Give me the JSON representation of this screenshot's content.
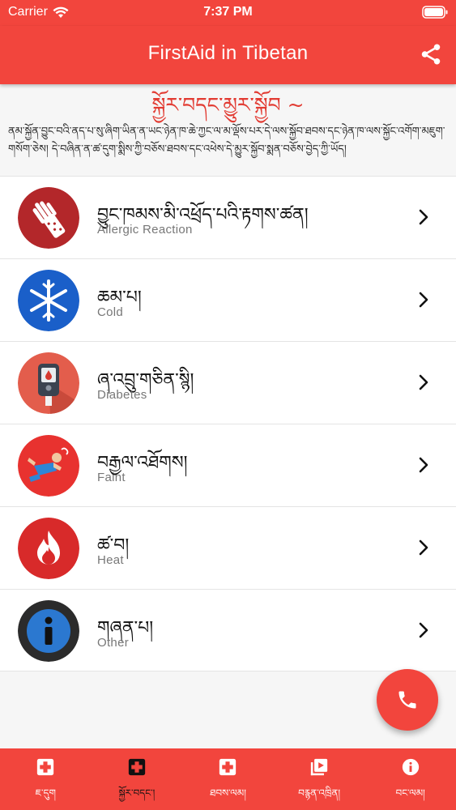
{
  "status_bar": {
    "carrier": "Carrier",
    "time": "7:37 PM"
  },
  "app_bar": {
    "title": "FirstAid in Tibetan"
  },
  "intro": {
    "title": "སྐྱོར་བདང་མྱུར་སྐྱོབ ~",
    "text": "ནམ་སྐྱོན་བྱུང་བའི་ནད་པ་སུ་ཞིག་ཡིན་ན་ཡང་ཉེན་ཁ་ཆེ་ཀྱང་ལ་མ་ལྡོས་པར་དེ་ལས་སྐྱོབ་ཐབས་དང་ཉེན་ཁ་ལས་སྐྱོང་འགོག་མཇུག་གསོག་ཅེས། དེ་བཞིན་ན་ཚ་དུག་སྨིས་ཀྱི་བཅོས་ཐབས་དང་འཕེས་དེ་མྱུར་སྐྱོབ་སྨན་བཅོས་བྱེད་ཀྱི་ཡོད།"
  },
  "items": [
    {
      "title": "བྱུང་ཁམས་མི་འཕྲོད་པའི་རྟགས་ཚན།",
      "subtitle": "Allergic Reaction"
    },
    {
      "title": "ཆམ་པ།",
      "subtitle": "Cold"
    },
    {
      "title": "ཞ་འབྲུ་གཅིན་སྙི།",
      "subtitle": "Diabetes"
    },
    {
      "title": "བརྒྱལ་འཐོགས།",
      "subtitle": "Faint"
    },
    {
      "title": "ཚ་བ།",
      "subtitle": "Heat"
    },
    {
      "title": "གཞན་པ།",
      "subtitle": "Other"
    }
  ],
  "bottom_nav": [
    {
      "label": "ཇ་དུག",
      "icon": "first-aid-icon"
    },
    {
      "label": "སྐྱོར་བདང་།",
      "icon": "first-aid-icon",
      "active": true
    },
    {
      "label": "ཐབས་ལམ།",
      "icon": "first-aid-icon"
    },
    {
      "label": "བརྙན་འཁྲིན།",
      "icon": "video-library-icon"
    },
    {
      "label": "བང་ལམ།",
      "icon": "info-icon"
    }
  ],
  "colors": {
    "primary": "#f2453d",
    "accent_text": "#e23b32"
  }
}
